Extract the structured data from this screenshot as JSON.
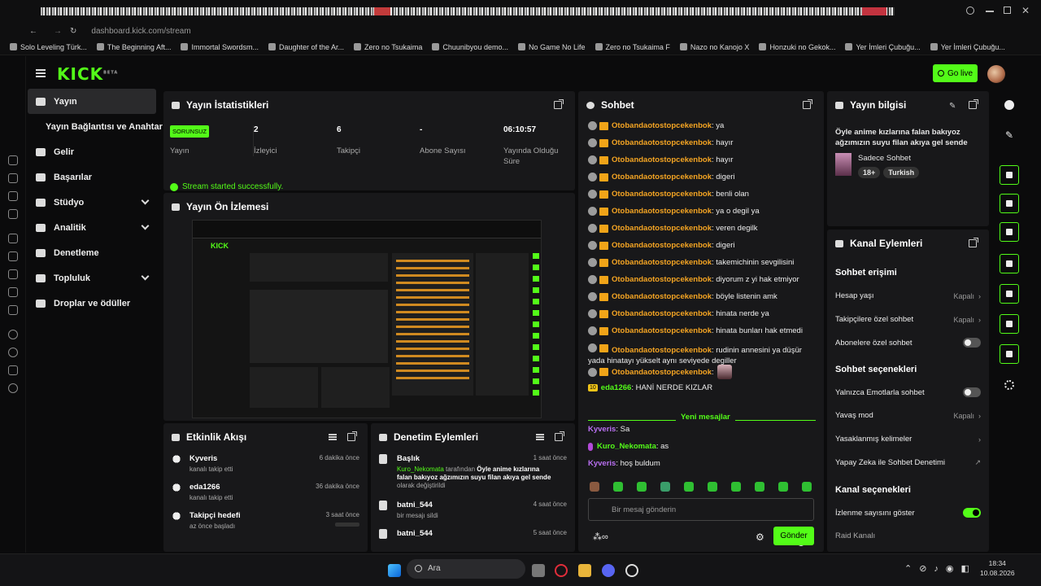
{
  "browser": {
    "url": "dashboard.kick.com/stream",
    "bookmarks": [
      "Solo Leveling Türk...",
      "The Beginning Aft...",
      "Immortal Swordsm...",
      "Daughter of the Ar...",
      "Zero no Tsukaima",
      "Chuunibyou demo...",
      "No Game No Life",
      "Zero no Tsukaima F",
      "Nazo no Kanojo X",
      "Honzuki no Gekok...",
      "Yer İmleri Çubuğu...",
      "Yer İmleri Çubuğu..."
    ]
  },
  "header": {
    "logo": "KICK",
    "logo_sup": "BETA",
    "go_live": "Go live"
  },
  "nav": [
    {
      "label": "Yayın",
      "active": true
    },
    {
      "label": "Yayın Bağlantısı ve Anahtarı",
      "sub": true
    },
    {
      "label": "Gelir"
    },
    {
      "label": "Başarılar"
    },
    {
      "label": "Stüdyo",
      "chevron": true
    },
    {
      "label": "Analitik",
      "chevron": true
    },
    {
      "label": "Denetleme"
    },
    {
      "label": "Topluluk",
      "chevron": true
    },
    {
      "label": "Droplar ve ödüller"
    }
  ],
  "stats": {
    "title": "Yayın İstatistikleri",
    "status_badge": "SORUNSUZ",
    "status_label": "Yayın",
    "viewers": "2",
    "viewers_label": "İzleyici",
    "followers": "6",
    "followers_label": "Takipçi",
    "subs": "-",
    "subs_label": "Abone Sayısı",
    "uptime": "06:10:57",
    "uptime_label": "Yayında Olduğu Süre",
    "success": "Stream started successfully."
  },
  "preview": {
    "title": "Yayın Ön İzlemesi"
  },
  "activity": {
    "title": "Etkinlik Akışı",
    "items": [
      {
        "name": "Kyveris",
        "sub": "kanalı takip etti",
        "time": "6 dakika önce"
      },
      {
        "name": "eda1266",
        "sub": "kanalı takip etti",
        "time": "36 dakika önce"
      },
      {
        "name": "Takipçi hedefi",
        "sub": "az önce başladı",
        "time": "3 saat önce"
      }
    ]
  },
  "moderation": {
    "title": "Denetim Eylemleri",
    "items": [
      {
        "name": "Başlık",
        "actor": "Kuro_Nekomata",
        "mid": " tarafından ",
        "quote": "Öyle anime kızlarına falan bakıyoz ağzımızın suyu filan akıya gel sende",
        "tail": " olarak değiştirildi",
        "time": "1 saat önce"
      },
      {
        "name": "batni_544",
        "sub": "bir mesajı sildi",
        "time": "4 saat önce"
      },
      {
        "name": "batni_544",
        "sub": "",
        "time": "5 saat önce"
      }
    ]
  },
  "chat": {
    "title": "Sohbet",
    "user": "Otobandaotostopcekenbok",
    "messages": [
      "ya",
      "hayır",
      "hayır",
      "digeri",
      "benli olan",
      "ya o degil ya",
      "veren degilk",
      "digeri",
      "takemichinin sevgilisini",
      "diyorum z yi hak etmiyor",
      "böyle listenin amk",
      "hinata nerde ya",
      "hinata bunları hak etmedi",
      "rudinin annesini ya düşür yada hinatayı yükselt aynı seviyede degiller",
      ""
    ],
    "eda_badge": "10",
    "eda_user": "eda1266",
    "eda_msg": "HANİ NERDE KIZLAR",
    "new_messages": "Yeni mesajlar",
    "after": [
      {
        "user": "Kyveris",
        "msg": "Sa"
      },
      {
        "user": "Kuro_Nekomata",
        "msg": "as"
      },
      {
        "user": "Kyveris",
        "msg": "hoş buldum"
      }
    ],
    "placeholder": "Bir mesaj gönderin",
    "send": "Gönder"
  },
  "info": {
    "title": "Yayın bilgisi",
    "stream_title": "Öyle anime kızlarına falan bakıyoz ağzımızın suyu filan akıya gel sende",
    "category": "Sadece Sohbet",
    "tags": [
      "18+",
      "Turkish"
    ]
  },
  "channel": {
    "title": "Kanal Eylemleri",
    "chat_access": "Sohbet erişimi",
    "account_age": "Hesap yaşı",
    "account_age_val": "Kapalı",
    "followers_only": "Takipçilere özel sohbet",
    "followers_only_val": "Kapalı",
    "subs_only": "Abonelere özel sohbet",
    "chat_options": "Sohbet seçenekleri",
    "emote_only": "Yalnızca Emotlarla sohbet",
    "slow": "Yavaş mod",
    "slow_val": "Kapalı",
    "banned": "Yasaklanmış kelimeler",
    "ai_mod": "Yapay Zeka ile Sohbet Denetimi",
    "channel_options": "Kanal seçenekleri",
    "show_viewers": "İzlenme sayısını göster",
    "raid": "Raid Kanalı"
  },
  "taskbar": {
    "search": "Ara",
    "time": "18:34",
    "date": "10.08.2026"
  }
}
